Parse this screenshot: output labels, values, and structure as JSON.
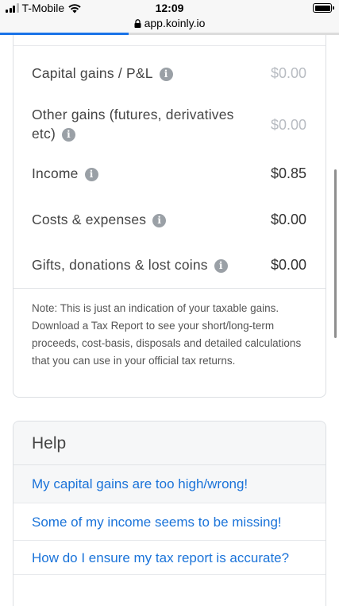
{
  "status_bar": {
    "carrier": "T-Mobile",
    "time": "12:09"
  },
  "browser": {
    "url": "app.koinly.io",
    "load_progress": 0.38
  },
  "summary": {
    "rows": [
      {
        "label": "Capital gains / P&L",
        "value": "$0.00",
        "muted": true
      },
      {
        "label": "Other gains (futures, derivatives etc)",
        "value": "$0.00",
        "muted": true
      },
      {
        "label": "Income",
        "value": "$0.85",
        "muted": false
      },
      {
        "label": "Costs & expenses",
        "value": "$0.00",
        "muted": false
      },
      {
        "label": "Gifts, donations & lost coins",
        "value": "$0.00",
        "muted": false
      }
    ],
    "note": "Note: This is just an indication of your taxable gains. Download a Tax Report to see your short/long-term proceeds, cost-basis, disposals and detailed calculations that you can use in your official tax returns."
  },
  "help": {
    "title": "Help",
    "links": [
      "My capital gains are too high/wrong!",
      "Some of my income seems to be missing!",
      "How do I ensure my tax report is accurate?"
    ]
  },
  "colors": {
    "link": "#1a73d9",
    "muted_value": "#b8bcc2",
    "progress": "#1a73e8"
  }
}
